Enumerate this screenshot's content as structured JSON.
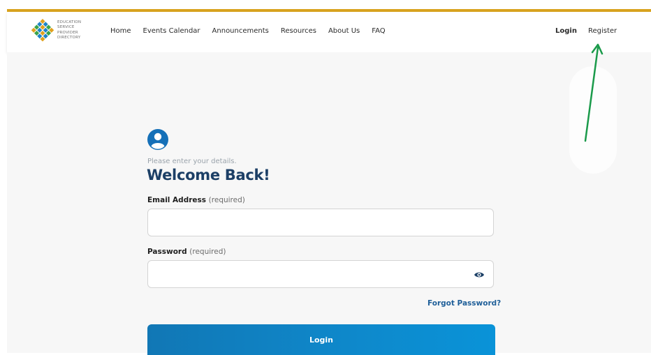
{
  "brand": {
    "logo_lines": [
      "EDUCATION",
      "SERVICE",
      "PROVIDER",
      "DIRECTORY"
    ],
    "colors": {
      "accent_bar": "#d9a31e",
      "title": "#1c3f66",
      "link": "#1f5f99",
      "button": "#0f86c8"
    }
  },
  "nav": {
    "items": [
      {
        "label": "Home"
      },
      {
        "label": "Events Calendar"
      },
      {
        "label": "Announcements"
      },
      {
        "label": "Resources"
      },
      {
        "label": "About Us"
      },
      {
        "label": "FAQ"
      }
    ],
    "login_label": "Login",
    "register_label": "Register"
  },
  "form": {
    "avatar_icon": "user-circle-icon",
    "subtitle": "Please enter your details.",
    "title": "Welcome Back!",
    "email": {
      "label": "Email Address",
      "required": "(required)",
      "value": "",
      "placeholder": ""
    },
    "password": {
      "label": "Password",
      "required": "(required)",
      "value": "",
      "placeholder": "",
      "toggle_icon": "eye-icon"
    },
    "forgot_label": "Forgot Password?",
    "submit_label": "Login"
  },
  "annotation": {
    "type": "arrow",
    "color": "#1a9a4a",
    "points_to": "register-link"
  }
}
